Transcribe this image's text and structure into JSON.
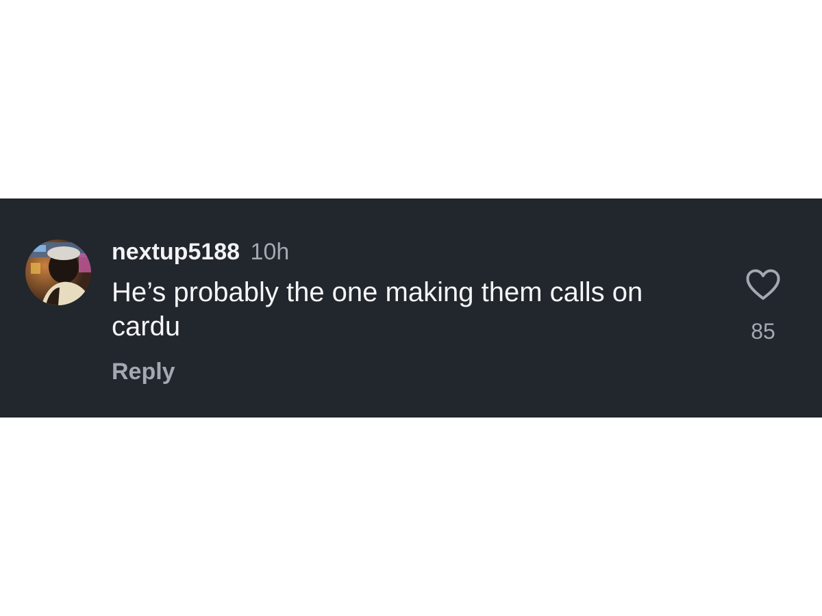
{
  "comment": {
    "username": "nextup5188",
    "timestamp": "10h",
    "text": "He’s probably the one making them calls on cardu",
    "reply_label": "Reply",
    "like_count": "85",
    "like_icon": "heart-outline-icon"
  },
  "colors": {
    "panel_background": "#22262d",
    "primary_text": "#f2f3f5",
    "secondary_text": "#a4a9b1",
    "page_background": "#ffffff"
  }
}
